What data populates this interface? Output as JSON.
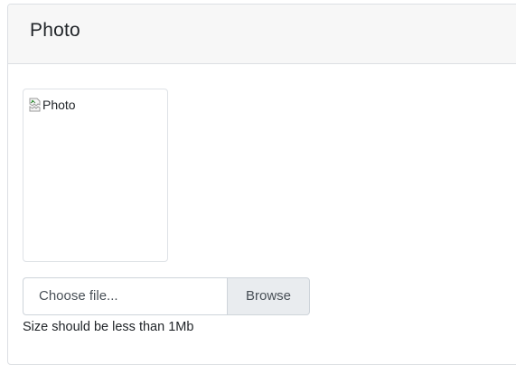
{
  "card": {
    "title": "Photo"
  },
  "photo": {
    "alt_text": "Photo"
  },
  "file_upload": {
    "placeholder": "Choose file...",
    "browse_label": "Browse",
    "help_text": "Size should be less than 1Mb"
  },
  "icons": {
    "broken_image": "broken-image-icon"
  }
}
